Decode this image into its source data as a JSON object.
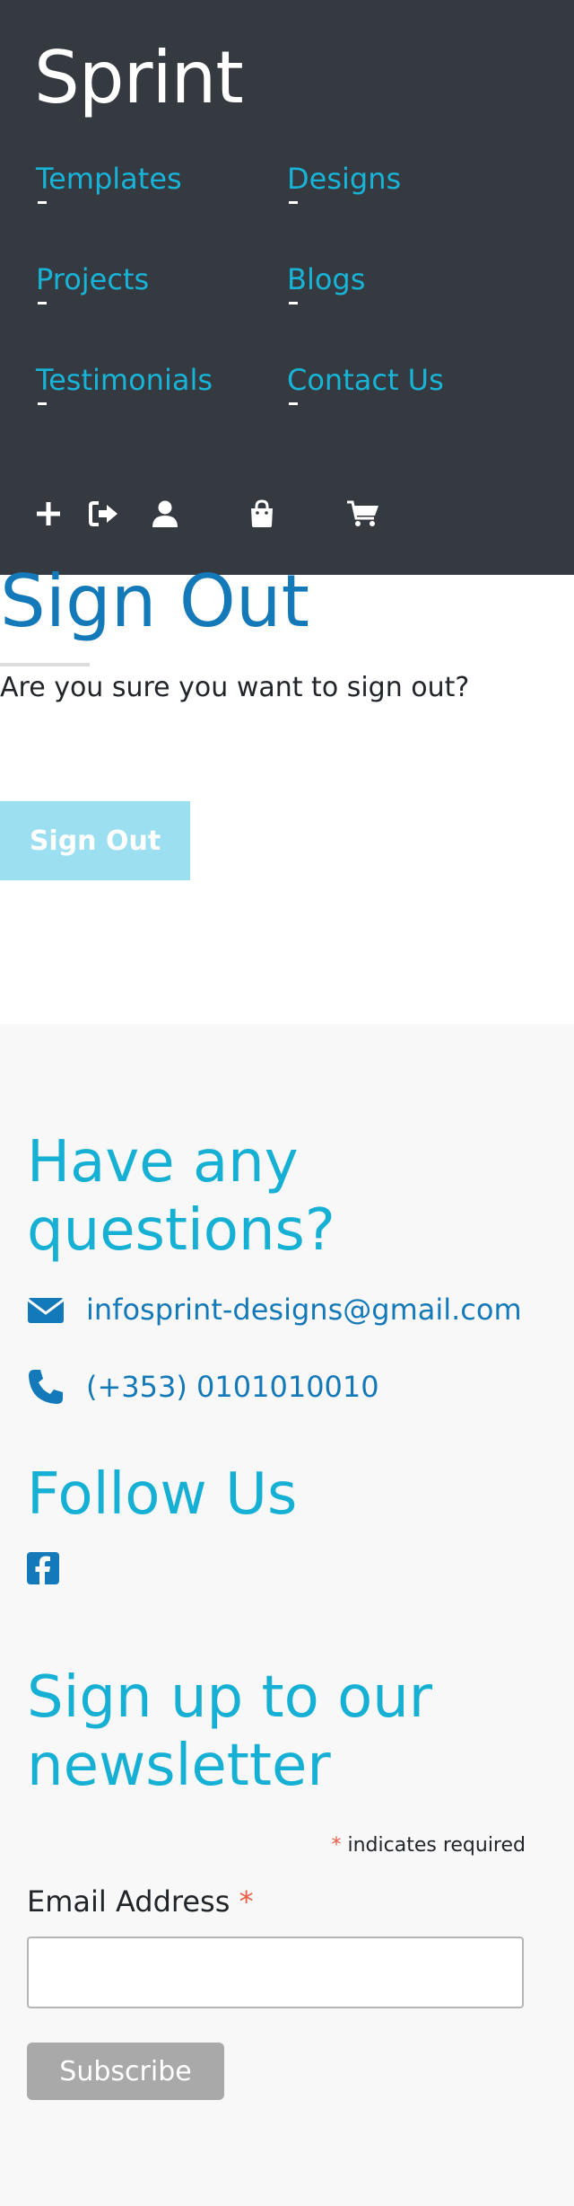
{
  "header": {
    "brand": "Sprint",
    "nav": [
      {
        "label": "Templates"
      },
      {
        "label": "Designs"
      },
      {
        "label": "Projects"
      },
      {
        "label": "Blogs"
      },
      {
        "label": "Testimonials"
      },
      {
        "label": "Contact Us"
      }
    ],
    "icons": [
      "plus-icon",
      "sign-out-icon",
      "user-icon",
      "shopping-bag-icon",
      "shopping-cart-icon"
    ]
  },
  "signout": {
    "title": "Sign Out",
    "message": "Are you sure you want to sign out?",
    "button_label": "Sign Out"
  },
  "footer": {
    "questions_heading_line1": "Have any",
    "questions_heading_line2": "questions?",
    "email": "infosprint-designs@gmail.com",
    "phone": "(+353) 0101010010",
    "follow_heading": "Follow Us",
    "newsletter_heading_line1": "Sign up to our",
    "newsletter_heading_line2": "newsletter",
    "required_star": "*",
    "required_note": " indicates required",
    "email_label": "Email Address ",
    "email_value": "",
    "subscribe_label": "Subscribe"
  },
  "colors": {
    "header_bg": "#343a40",
    "nav_link": "#17b4d8",
    "title_blue": "#1479b8",
    "heading_cyan": "#17b0d5",
    "signout_button": "#9bdff0",
    "footer_bg": "#f8f8f8",
    "subscribe_button": "#a9a9a9",
    "required_red": "#e85c41"
  }
}
